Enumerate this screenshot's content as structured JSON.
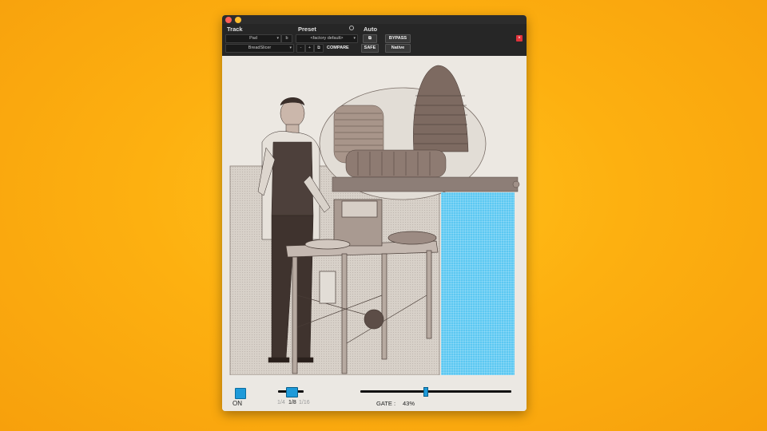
{
  "header": {
    "track_label": "Track",
    "preset_label": "Preset",
    "auto_label": "Auto",
    "track_name": "Pad",
    "track_slot": "b",
    "plugin_name": "BreadSlicer",
    "preset_value": "<factory default>",
    "prev_symbol": "-",
    "next_symbol": "+",
    "compare_label": "COMPARE",
    "bypass_label": "BYPASS",
    "safe_label": "SAFE",
    "native_label": "Native"
  },
  "photo": {
    "description_icon": "bread-slicer-illustration"
  },
  "footer": {
    "on_label": "ON",
    "rate_options": [
      "1/4",
      "1/8",
      "1/16"
    ],
    "rate_selected": "1/8",
    "gate_label": "GATE :",
    "gate_value": "43%",
    "gate_fraction": 0.43
  },
  "colors": {
    "accent": "#1e9ad9",
    "meter": "#5cc8f2",
    "background": "#fdb010"
  }
}
